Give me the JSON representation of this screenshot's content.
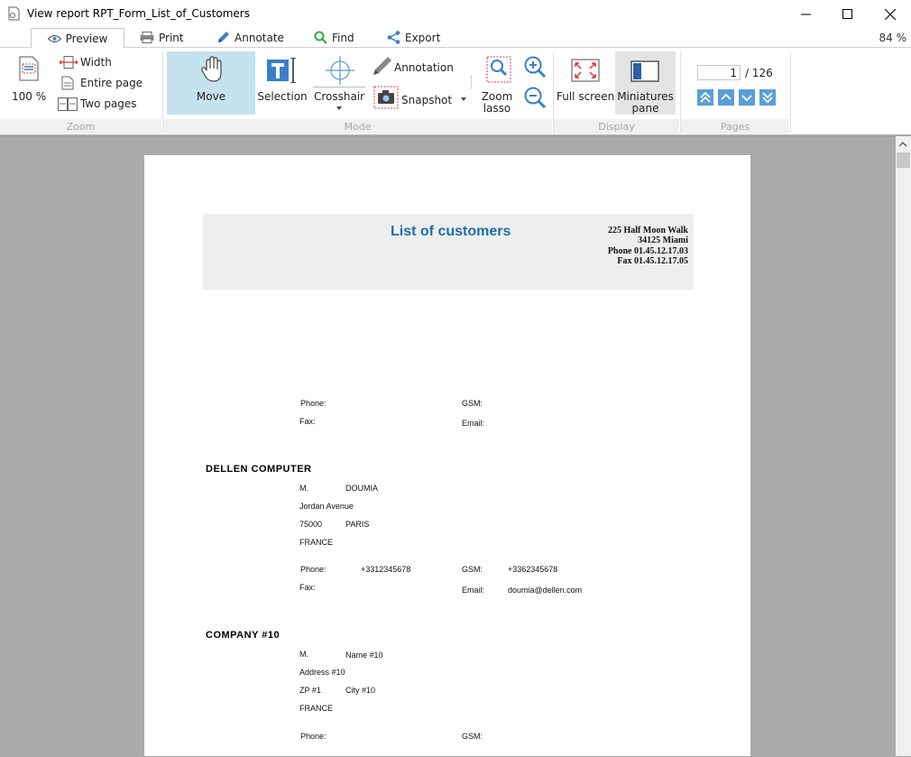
{
  "window": {
    "title": "View report RPT_Form_List_of_Customers"
  },
  "tabs": [
    {
      "label": "Preview",
      "icon": "eye-icon"
    },
    {
      "label": "Print",
      "icon": "printer-icon"
    },
    {
      "label": "Annotate",
      "icon": "pencil-icon"
    },
    {
      "label": "Find",
      "icon": "search-icon"
    },
    {
      "label": "Export",
      "icon": "share-icon"
    }
  ],
  "zoom_readout": "84 %",
  "ribbon": {
    "zoom": {
      "hundred": "100 %",
      "width": "Width",
      "entire_page": "Entire page",
      "two_pages": "Two pages",
      "footer": "Zoom"
    },
    "mode": {
      "move": "Move",
      "selection": "Selection",
      "crosshair": "Crosshair",
      "annotation": "Annotation",
      "snapshot": "Snapshot",
      "zoom_lasso_1": "Zoom",
      "zoom_lasso_2": "lasso",
      "footer": "Mode"
    },
    "display": {
      "full_screen": "Full screen",
      "miniatures_1": "Miniatures",
      "miniatures_2": "pane",
      "footer": "Display"
    },
    "pages": {
      "current": "1",
      "total": "/ 126",
      "footer": "Pages"
    }
  },
  "report": {
    "title": "List of customers",
    "address": [
      "225 Half Moon Walk",
      "34125 Miami",
      "Phone 01.45.12.17.03",
      "Fax 01.45.12.17.05"
    ],
    "labels": {
      "phone": "Phone:",
      "gsm": "GSM:",
      "fax": "Fax:",
      "email": "Email:"
    },
    "customers": [
      {
        "company": "DELLEN COMPUTER",
        "title": "M.",
        "name": "DOUMIA",
        "address": "Jordan Avenue",
        "zip": "75000",
        "city": "PARIS",
        "country": "FRANCE",
        "phone": "+3312345678",
        "gsm": "+3362345678",
        "email": "doumia@dellen.com"
      },
      {
        "company": "COMPANY #10",
        "title": "M.",
        "name": "Name #10",
        "address": "Address #10",
        "zip": "ZP #1",
        "city": "City #10",
        "country": "FRANCE"
      }
    ]
  }
}
